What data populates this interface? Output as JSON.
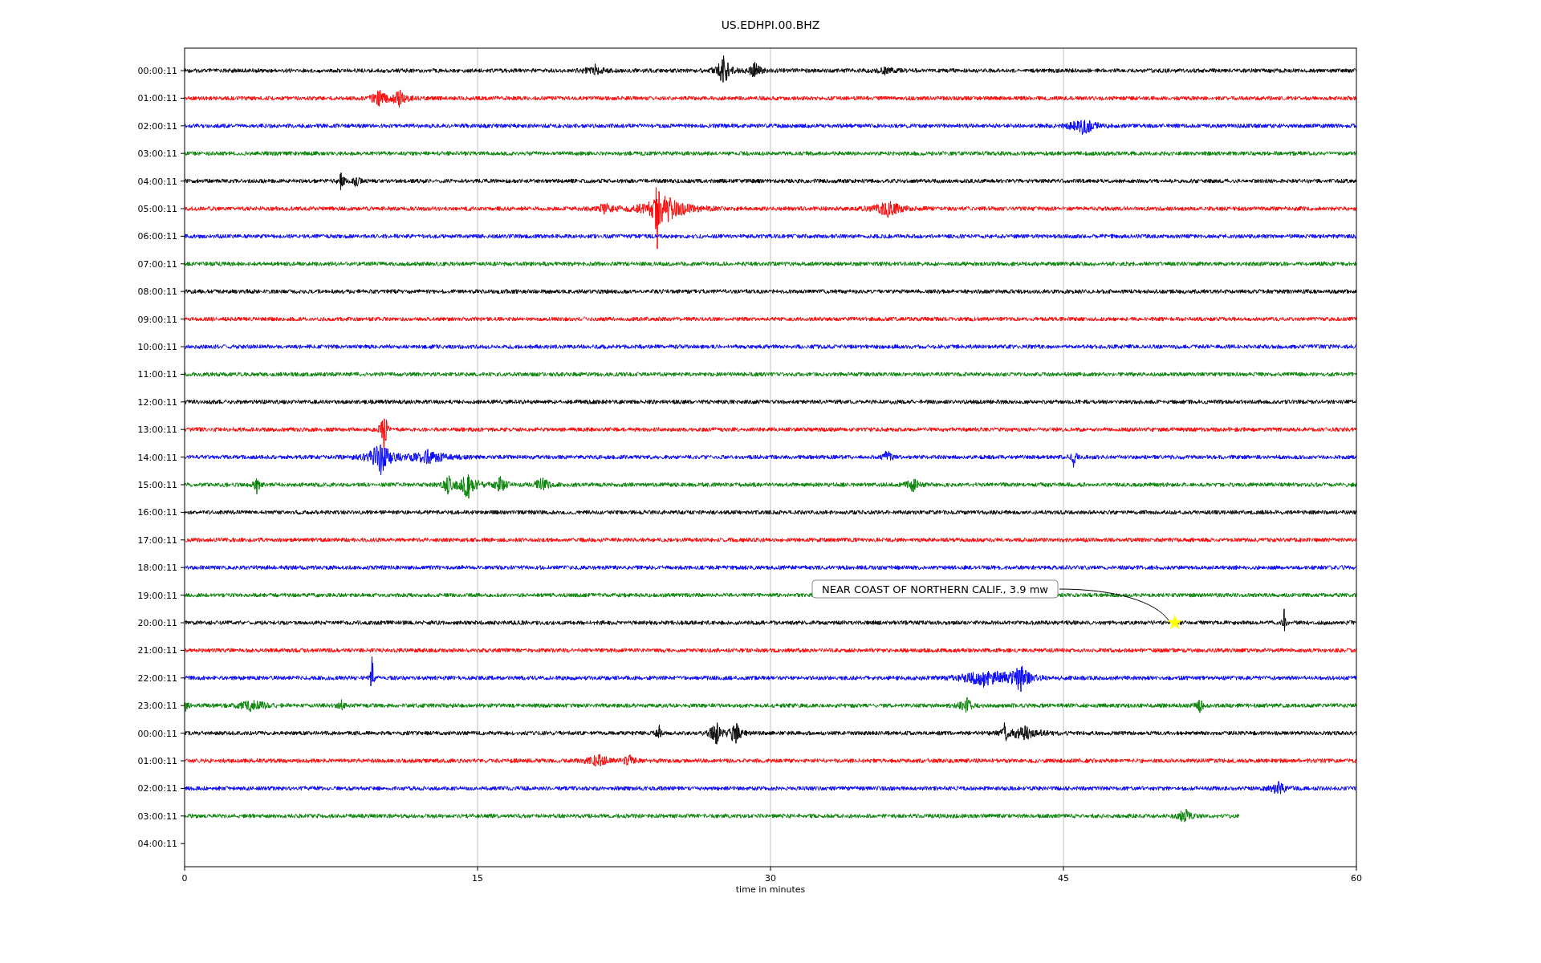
{
  "title": "US.EDHPI.00.BHZ",
  "rows": [
    {
      "time": "00:00:11",
      "color": "#000000"
    },
    {
      "time": "01:00:11",
      "color": "#ff0000"
    },
    {
      "time": "02:00:11",
      "color": "#0000ff"
    },
    {
      "time": "03:00:11",
      "color": "#008000"
    },
    {
      "time": "04:00:11",
      "color": "#000000"
    },
    {
      "time": "05:00:11",
      "color": "#ff0000"
    },
    {
      "time": "06:00:11",
      "color": "#0000ff"
    },
    {
      "time": "07:00:11",
      "color": "#008000"
    },
    {
      "time": "08:00:11",
      "color": "#000000"
    },
    {
      "time": "09:00:11",
      "color": "#ff0000"
    },
    {
      "time": "10:00:11",
      "color": "#0000ff"
    },
    {
      "time": "11:00:11",
      "color": "#008000"
    },
    {
      "time": "12:00:11",
      "color": "#000000"
    },
    {
      "time": "13:00:11",
      "color": "#ff0000"
    },
    {
      "time": "14:00:11",
      "color": "#0000ff"
    },
    {
      "time": "15:00:11",
      "color": "#008000"
    },
    {
      "time": "16:00:11",
      "color": "#000000"
    },
    {
      "time": "17:00:11",
      "color": "#ff0000"
    },
    {
      "time": "18:00:11",
      "color": "#0000ff"
    },
    {
      "time": "19:00:11",
      "color": "#008000"
    },
    {
      "time": "20:00:11",
      "color": "#000000"
    },
    {
      "time": "21:00:11",
      "color": "#ff0000"
    },
    {
      "time": "22:00:11",
      "color": "#0000ff"
    },
    {
      "time": "23:00:11",
      "color": "#008000"
    },
    {
      "time": "00:00:11",
      "color": "#000000"
    },
    {
      "time": "01:00:11",
      "color": "#ff0000"
    },
    {
      "time": "02:00:11",
      "color": "#0000ff"
    },
    {
      "time": "03:00:11",
      "color": "#008000",
      "level": 0.9
    },
    {
      "time": "04:00:11"
    }
  ],
  "x_ticks": [
    "0",
    "15",
    "30",
    "45",
    "60"
  ],
  "xlabel": "time in minutes",
  "annotation": {
    "text": "NEAR COAST OF NORTHERN CALIF., 3.9 mw"
  }
}
